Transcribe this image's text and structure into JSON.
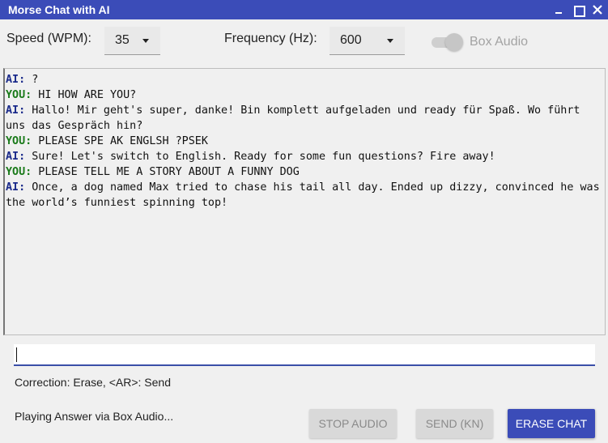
{
  "window": {
    "title": "Morse Chat with AI"
  },
  "controls": {
    "speed_label": "Speed (WPM):",
    "speed_value": "35",
    "frequency_label": "Frequency (Hz):",
    "frequency_value": "600",
    "box_audio_label": "Box Audio",
    "box_audio_enabled": false
  },
  "chat": {
    "messages": [
      {
        "speaker": "AI:",
        "text": " ?"
      },
      {
        "speaker": "YOU:",
        "text": " HI HOW ARE YOU?"
      },
      {
        "speaker": "AI:",
        "text": " Hallo! Mir geht's super, danke! Bin komplett aufgeladen und ready für Spaß. Wo führt uns das Gespräch hin?"
      },
      {
        "speaker": "YOU:",
        "text": " PLEASE SPE AK ENGLSH ?PSEK"
      },
      {
        "speaker": "AI:",
        "text": " Sure! Let's switch to English. Ready for some fun questions? Fire away!"
      },
      {
        "speaker": "YOU:",
        "text": " PLEASE TELL ME A STORY ABOUT A FUNNY DOG"
      },
      {
        "speaker": "AI:",
        "text": " Once, a dog named Max tried to chase his tail all day. Ended up dizzy, convinced he was the world’s funniest spinning top!"
      }
    ]
  },
  "input": {
    "value": "",
    "placeholder": ""
  },
  "hint": "Correction: Erase, <AR>: Send",
  "status": "Playing Answer via Box Audio...",
  "buttons": {
    "stop_audio": "STOP AUDIO",
    "send": "SEND (KN)",
    "erase_chat": "ERASE CHAT"
  },
  "colors": {
    "accent": "#3b4cb8",
    "ai_speaker": "#1a2a8a",
    "you_speaker": "#1a7a1a"
  }
}
